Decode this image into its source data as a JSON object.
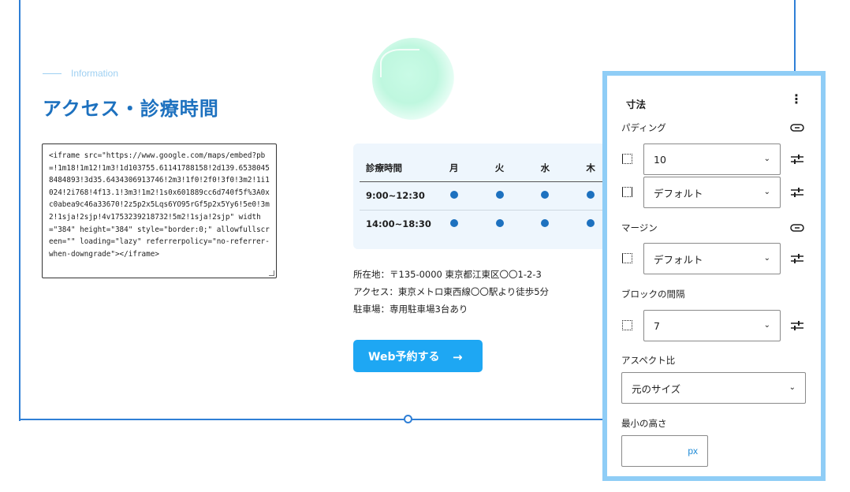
{
  "content": {
    "info_label": "Information",
    "title": "アクセス・診療時間",
    "code": "<iframe src=\"https://www.google.com/maps/embed?pb=!1m18!1m12!1m3!1d103755.61141788158!2d139.65380458484893!3d35.6434306913746!2m3!1f0!2f0!3f0!3m2!1i1024!2i768!4f13.1!3m3!1m2!1s0x601889cc6d740f5f%3A0xc0abea9c46a33670!2z5p2x5Lqs6YO95rGf5p2x5Yy6!5e0!3m2!1sja!2sjp!4v1753239218732!5m2!1sja!2sjp\" width=\"384\" height=\"384\" style=\"border:0;\" allowfullscreen=\"\" loading=\"lazy\" referrerpolicy=\"no-referrer-when-downgrade\"></iframe>",
    "schedule": {
      "header": [
        "診療時間",
        "月",
        "火",
        "水",
        "木"
      ],
      "rows": [
        {
          "time": "9:00~12:30",
          "open": [
            true,
            true,
            true,
            true
          ]
        },
        {
          "time": "14:00~18:30",
          "open": [
            true,
            true,
            true,
            true
          ]
        }
      ]
    },
    "address": "所在地：〒135-0000 東京都江東区〇〇1-2-3",
    "access": "アクセス：東京メトロ東西線〇〇駅より徒歩5分",
    "parking": "駐車場：専用駐車場3台あり",
    "reserve_label": "Web予約する",
    "reserve_arrow": "→"
  },
  "panel": {
    "title": "寸法",
    "more": "⋮",
    "padding_label": "パディング",
    "padding_vertical": "10",
    "padding_horizontal": "デフォルト",
    "margin_label": "マージン",
    "margin_vertical": "デフォルト",
    "block_gap_label": "ブロックの間隔",
    "block_gap": "7",
    "aspect_label": "アスペクト比",
    "aspect_value": "元のサイズ",
    "min_height_label": "最小の高さ",
    "min_height_value": "",
    "min_height_unit": "px",
    "chevron": "⌄"
  },
  "colors": {
    "accent": "#1d71bf",
    "button": "#1ea7f3",
    "frame": "#2f7fd6",
    "panel_border": "#8fcdf6"
  }
}
